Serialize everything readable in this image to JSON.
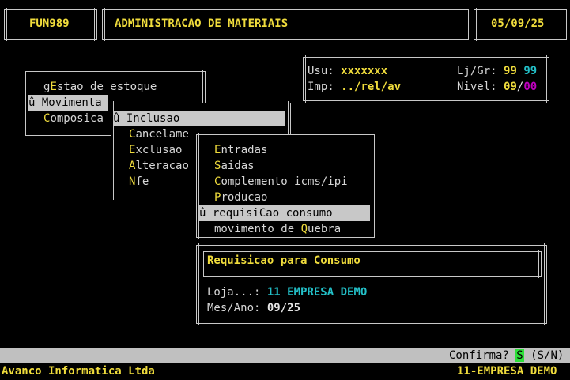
{
  "header": {
    "code": "FUN989",
    "title": "ADMINISTRACAO DE MATERIAIS",
    "date": "05/09/25"
  },
  "info": {
    "usu_label": "Usu:",
    "usu_value": "xxxxxxx",
    "imp_label": "Imp:",
    "imp_value": "../rel/av",
    "ljgr_label": "Lj/Gr:",
    "lj_value": "99",
    "gr_value": "99",
    "nivel_label": "Nivel:",
    "nivel_a": "09",
    "nivel_sep": "/",
    "nivel_b": "00"
  },
  "menu1": {
    "items": [
      {
        "pre": "g",
        "hk": "E",
        "post": "stao de estoque"
      },
      {
        "pre": "û Movimenta",
        "hk": "",
        "post": ""
      },
      {
        "pre": "",
        "hk": "C",
        "post": "omposica"
      }
    ]
  },
  "menu2": {
    "items": [
      {
        "pre": "û ",
        "hk": "I",
        "post": "nclusao"
      },
      {
        "pre": "",
        "hk": "C",
        "post": "ancelame"
      },
      {
        "pre": "",
        "hk": "E",
        "post": "xclusao"
      },
      {
        "pre": "",
        "hk": "A",
        "post": "lteracao"
      },
      {
        "pre": "",
        "hk": "N",
        "post": "fe"
      }
    ]
  },
  "menu3": {
    "items": [
      {
        "pre": "",
        "hk": "E",
        "post": "ntradas"
      },
      {
        "pre": "",
        "hk": "S",
        "post": "aidas"
      },
      {
        "pre": "",
        "hk": "C",
        "post": "omplemento icms/ipi"
      },
      {
        "pre": "",
        "hk": "P",
        "post": "roducao"
      },
      {
        "pre": "û requisi",
        "hk": "C",
        "post": "ao consumo"
      },
      {
        "pre": "movimento de ",
        "hk": "Q",
        "post": "uebra"
      }
    ]
  },
  "dialog": {
    "title": "Requisicao para Consumo",
    "loja_label": "Loja...:",
    "loja_value": "11 EMPRESA DEMO",
    "mes_label": "Mes/Ano:",
    "mes_value": "09/25"
  },
  "status": {
    "prompt": "Confirma?",
    "answer": "S",
    "options": "(S/N)"
  },
  "footer": {
    "company": "Avanco Informatica Ltda",
    "store": "11-EMPRESA DEMO"
  },
  "colors": {
    "yellow": "#f0dc3c",
    "cyan": "#23c0c8",
    "magenta": "#c000c0",
    "selection": "#c8c8c8",
    "confirm_green": "#2ee03a"
  }
}
